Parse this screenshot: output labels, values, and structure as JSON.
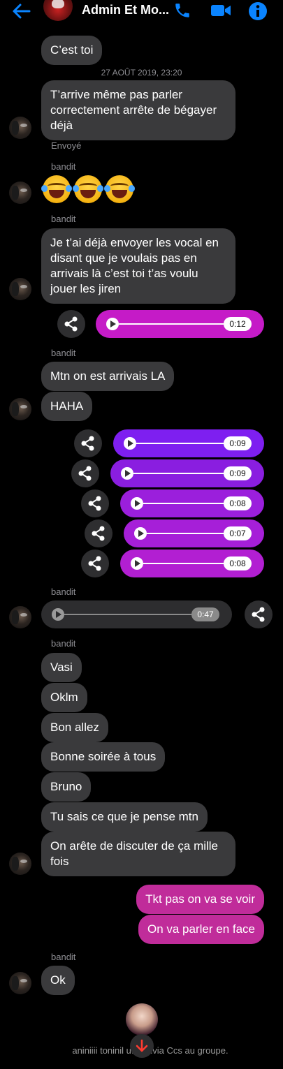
{
  "header": {
    "title": "Admin Et Mo...",
    "back_icon": "arrow-left-icon",
    "call_icon": "phone-icon",
    "video_icon": "video-camera-icon",
    "info_icon": "info-icon",
    "accent_color": "#0a84ff"
  },
  "colors": {
    "background": "#000000",
    "incoming_bubble": "#3a3a3c",
    "outgoing_bubble": "#c02c9a",
    "audio_magenta": "#c51bc7",
    "audio_purple": "#7e1ff0"
  },
  "messages": {
    "m1": "C’est toi",
    "timestamp": "27 AOÛT 2019, 23:20",
    "m2": "T’arrive même pas parler correctement arrête de bégayer déjà",
    "sent_status": "Envoyé",
    "sender_1": "bandit",
    "emoji_count": 3,
    "sender_2": "bandit",
    "m3": "Je t’ai déjà envoyer les vocal en disant que je voulais pas en arrivais là c’est toi t’as voulu jouer les jiren",
    "audio_1": "0:12",
    "sender_3": "bandit",
    "m4": "Mtn on est arrivais LA",
    "m5": "HAHA",
    "audio_2": "0:09",
    "audio_3": "0:09",
    "audio_4": "0:08",
    "audio_5": "0:07",
    "audio_6": "0:08",
    "sender_4": "bandit",
    "audio_7": "0:47",
    "sender_5": "bandit",
    "m6": "Vasi",
    "m7": "Oklm",
    "m8": "Bon allez",
    "m9": "Bonne soirée à tous",
    "m10": "Bruno",
    "m11": "Tu sais ce que je pense mtn",
    "m12": "On arête de discuter de ça mille fois",
    "m13": "Tkt pas on va se voir",
    "m14": "On va parler en face",
    "sender_6": "bandit",
    "m15": "Ok"
  },
  "footer": {
    "system_text": "aniniiii toninil    uté Olivia Ccs au groupe.",
    "scroll_icon": "arrow-down-icon"
  }
}
